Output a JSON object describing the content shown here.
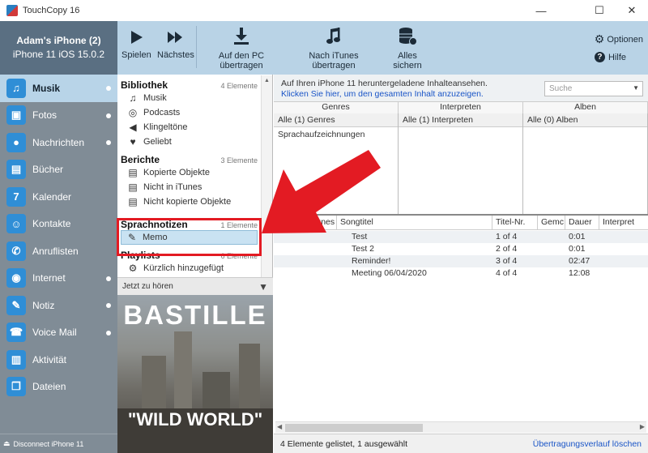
{
  "window": {
    "title": "TouchCopy 16"
  },
  "device": {
    "name": "Adam's iPhone (2)",
    "model": "iPhone 11 iOS 15.0.2"
  },
  "toolbar": {
    "play": "Spielen",
    "next": "Nächstes",
    "to_pc": "Auf den PC übertragen",
    "to_itunes": "Nach iTunes übertragen",
    "backup": "Alles sichern",
    "options": "Optionen",
    "help": "Hilfe"
  },
  "sidebar": {
    "items": [
      {
        "label": "Musik",
        "icon": "music-icon",
        "glyph": "♫",
        "dot": true
      },
      {
        "label": "Fotos",
        "icon": "photos-icon",
        "glyph": "▣",
        "dot": true
      },
      {
        "label": "Nachrichten",
        "icon": "messages-icon",
        "glyph": "●",
        "dot": true
      },
      {
        "label": "Bücher",
        "icon": "books-icon",
        "glyph": "▤",
        "dot": false
      },
      {
        "label": "Kalender",
        "icon": "calendar-icon",
        "glyph": "7",
        "dot": false
      },
      {
        "label": "Kontakte",
        "icon": "contacts-icon",
        "glyph": "☺",
        "dot": false
      },
      {
        "label": "Anruflisten",
        "icon": "phone-icon",
        "glyph": "✆",
        "dot": false
      },
      {
        "label": "Internet",
        "icon": "internet-icon",
        "glyph": "◉",
        "dot": true
      },
      {
        "label": "Notiz",
        "icon": "note-icon",
        "glyph": "✎",
        "dot": true
      },
      {
        "label": "Voice Mail",
        "icon": "voicemail-icon",
        "glyph": "☎",
        "dot": true
      },
      {
        "label": "Aktivität",
        "icon": "activity-icon",
        "glyph": "▥",
        "dot": false
      },
      {
        "label": "Dateien",
        "icon": "files-icon",
        "glyph": "❐",
        "dot": false
      }
    ],
    "disconnect": "Disconnect iPhone 11"
  },
  "library": {
    "bibliothek": {
      "title": "Bibliothek",
      "count": "4 Elemente",
      "items": [
        {
          "label": "Musik",
          "glyph": "♫"
        },
        {
          "label": "Podcasts",
          "glyph": "◎"
        },
        {
          "label": "Klingeltöne",
          "glyph": "◀"
        },
        {
          "label": "Geliebt",
          "glyph": "♥"
        }
      ]
    },
    "berichte": {
      "title": "Berichte",
      "count": "3 Elemente",
      "items": [
        {
          "label": "Kopierte Objekte",
          "glyph": "▤"
        },
        {
          "label": "Nicht in iTunes",
          "glyph": "▤"
        },
        {
          "label": "Nicht kopierte Objekte",
          "glyph": "▤"
        }
      ]
    },
    "sprachnotizen": {
      "title": "Sprachnotizen",
      "count": "1 Elemente",
      "items": [
        {
          "label": "Memo",
          "glyph": "✎"
        }
      ]
    },
    "playlists": {
      "title": "Playlists",
      "count": "6 Elemente",
      "items": [
        {
          "label": "Kürzlich hinzugefügt",
          "glyph": "⚙"
        }
      ]
    }
  },
  "now_playing": {
    "label": "Jetzt zu hören",
    "album_title": "BASTILLE",
    "album_subtitle": "\"WILD WORLD\""
  },
  "info": {
    "line1": "Auf Ihren iPhone 11 heruntergeladene Inhalteansehen.",
    "line2": "Klicken Sie hier, um den gesamten Inhalt anzuzeigen.",
    "search_placeholder": "Suche"
  },
  "filters": {
    "genres": {
      "header": "Genres",
      "all": "Alle (1) Genres",
      "rows": [
        "Sprachaufzeichnungen"
      ]
    },
    "artists": {
      "header": "Interpreten",
      "all": "Alle (1) Interpreten",
      "rows": []
    },
    "albums": {
      "header": "Alben",
      "all": "Alle (0) Alben",
      "rows": []
    }
  },
  "table": {
    "headers": [
      "Kopi",
      "iTunes",
      "Songtitel",
      "Titel-Nr.",
      "Gemc",
      "Dauer",
      "Interpret"
    ],
    "rows": [
      {
        "title": "Test",
        "track": "1 of 4",
        "duration": "0:01"
      },
      {
        "title": "Test 2",
        "track": "2 of 4",
        "duration": "0:01"
      },
      {
        "title": "Reminder!",
        "track": "3 of 4",
        "duration": "02:47"
      },
      {
        "title": "Meeting 06/04/2020",
        "track": "4 of 4",
        "duration": "12:08"
      }
    ]
  },
  "status": {
    "left": "4 Elemente gelistet, 1 ausgewählt",
    "right": "Übertragungsverlauf löschen"
  },
  "colors": {
    "accent": "#2f8ed6",
    "highlight": "#e31b23",
    "toolbar": "#b9d3e6",
    "sidebar": "#808c96"
  }
}
